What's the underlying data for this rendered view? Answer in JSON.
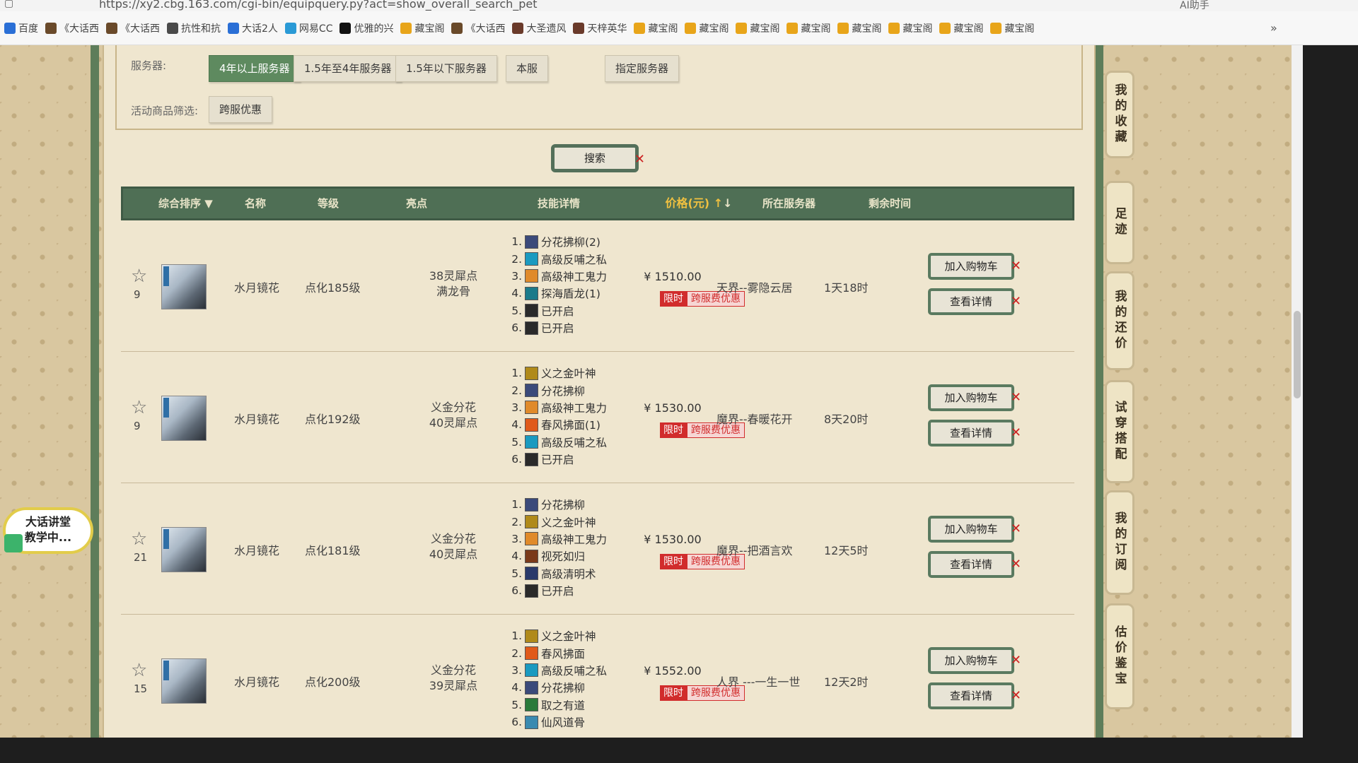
{
  "browser": {
    "url": "https://xy2.cbg.163.com/cgi-bin/equipquery.py?act=show_overall_search_pet",
    "bookmarks": [
      "百度",
      "《大话西",
      "《大话西",
      "抗性和抗",
      "大话2人",
      "网易CC",
      "优雅的兴",
      "藏宝阁",
      "《大话西",
      "大圣遗风",
      "天梓英华",
      "藏宝阁",
      "藏宝阁",
      "藏宝阁",
      "藏宝阁",
      "藏宝阁",
      "藏宝阁",
      "藏宝阁",
      "藏宝阁"
    ],
    "more": "»",
    "ai_label": "AI助手"
  },
  "filters": {
    "server_label": "服务器:",
    "server_options": [
      "4年以上服务器",
      "1.5年至4年服务器",
      "1.5年以下服务器",
      "本服",
      "指定服务器"
    ],
    "active_index": 0,
    "activity_label": "活动商品筛选:",
    "activity_options": [
      "跨服优惠"
    ],
    "search_label": "搜索"
  },
  "table": {
    "headers": {
      "sort": "综合排序",
      "name": "名称",
      "level": "等级",
      "highlight": "亮点",
      "skills": "技能详情",
      "price": "价格(元)",
      "server": "所在服务器",
      "time": "剩余时间"
    },
    "rows": [
      {
        "count": "9",
        "name": "水月镜花",
        "level": "点化185级",
        "highlight_1": "38灵犀点",
        "highlight_2": "满龙骨",
        "skills": [
          {
            "n": "1.",
            "t": "分花拂柳(2)",
            "c": "#3b4a7a"
          },
          {
            "n": "2.",
            "t": "高级反哺之私",
            "c": "#1a9ac0"
          },
          {
            "n": "3.",
            "t": "高级神工鬼力",
            "c": "#e08a2a"
          },
          {
            "n": "4.",
            "t": "探海盾龙(1)",
            "c": "#1b7a8a"
          },
          {
            "n": "5.",
            "t": "已开启",
            "c": "#2a2a2a"
          },
          {
            "n": "6.",
            "t": "已开启",
            "c": "#2a2a2a"
          }
        ],
        "price": "¥ 1510.00",
        "limit": "限时",
        "discount": "跨服费优惠",
        "server": "天界--雾隐云居",
        "time": "1天18时",
        "cart": "加入购物车",
        "detail": "查看详情"
      },
      {
        "count": "9",
        "name": "水月镜花",
        "level": "点化192级",
        "highlight_1": "义金分花",
        "highlight_2": "40灵犀点",
        "skills": [
          {
            "n": "1.",
            "t": "义之金叶神",
            "c": "#b08a1a"
          },
          {
            "n": "2.",
            "t": "分花拂柳",
            "c": "#3b4a7a"
          },
          {
            "n": "3.",
            "t": "高级神工鬼力",
            "c": "#e08a2a"
          },
          {
            "n": "4.",
            "t": "春风拂面(1)",
            "c": "#e05a1a"
          },
          {
            "n": "5.",
            "t": "高级反哺之私",
            "c": "#1a9ac0"
          },
          {
            "n": "6.",
            "t": "已开启",
            "c": "#2a2a2a"
          }
        ],
        "price": "¥ 1530.00",
        "limit": "限时",
        "discount": "跨服费优惠",
        "server": "魔界--春暖花开",
        "time": "8天20时",
        "cart": "加入购物车",
        "detail": "查看详情"
      },
      {
        "count": "21",
        "name": "水月镜花",
        "level": "点化181级",
        "highlight_1": "义金分花",
        "highlight_2": "40灵犀点",
        "skills": [
          {
            "n": "1.",
            "t": "分花拂柳",
            "c": "#3b4a7a"
          },
          {
            "n": "2.",
            "t": "义之金叶神",
            "c": "#b08a1a"
          },
          {
            "n": "3.",
            "t": "高级神工鬼力",
            "c": "#e08a2a"
          },
          {
            "n": "4.",
            "t": "视死如归",
            "c": "#7a3a1a"
          },
          {
            "n": "5.",
            "t": "高级清明术",
            "c": "#2a3a6a"
          },
          {
            "n": "6.",
            "t": "已开启",
            "c": "#2a2a2a"
          }
        ],
        "price": "¥ 1530.00",
        "limit": "限时",
        "discount": "跨服费优惠",
        "server": "魔界--把酒言欢",
        "time": "12天5时",
        "cart": "加入购物车",
        "detail": "查看详情"
      },
      {
        "count": "15",
        "name": "水月镜花",
        "level": "点化200级",
        "highlight_1": "义金分花",
        "highlight_2": "39灵犀点",
        "skills": [
          {
            "n": "1.",
            "t": "义之金叶神",
            "c": "#b08a1a"
          },
          {
            "n": "2.",
            "t": "春风拂面",
            "c": "#e05a1a"
          },
          {
            "n": "3.",
            "t": "高级反哺之私",
            "c": "#1a9ac0"
          },
          {
            "n": "4.",
            "t": "分花拂柳",
            "c": "#3b4a7a"
          },
          {
            "n": "5.",
            "t": "取之有道",
            "c": "#2a7a3a"
          },
          {
            "n": "6.",
            "t": "仙风道骨",
            "c": "#3a8ab0"
          }
        ],
        "price": "¥ 1552.00",
        "limit": "限时",
        "discount": "跨服费优惠",
        "server": "人界 ---一生一世",
        "time": "12天2时",
        "cart": "加入购物车",
        "detail": "查看详情"
      }
    ]
  },
  "side_tabs": [
    "我的收藏",
    "足迹",
    "我的还价",
    "试穿搭配",
    "我的订阅",
    "估价鉴宝"
  ],
  "float_badge": {
    "line1": "大话讲堂",
    "line2": "教学中..."
  }
}
